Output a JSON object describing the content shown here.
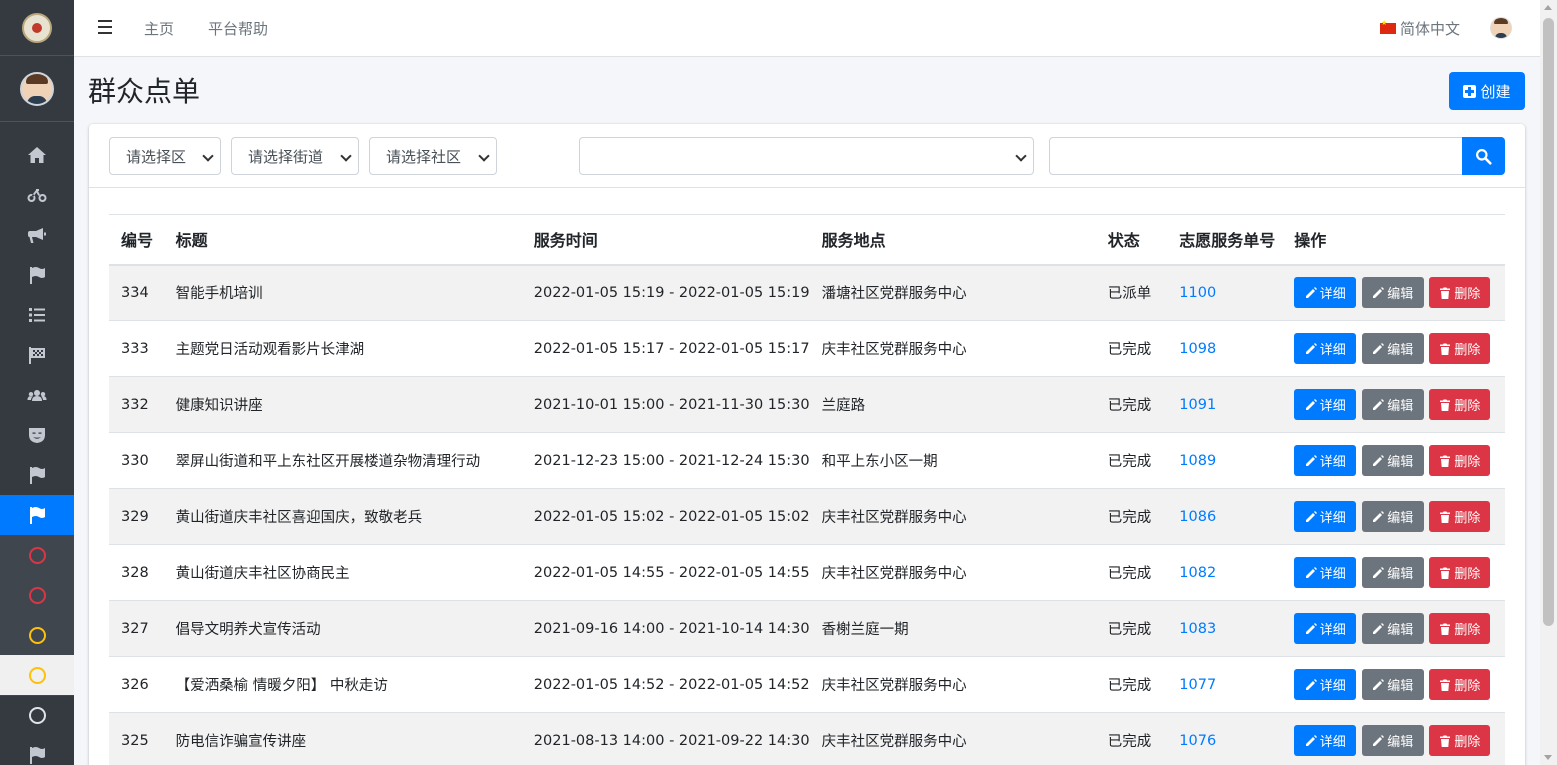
{
  "topbar": {
    "links": [
      "主页",
      "平台帮助"
    ],
    "language": "简体中文"
  },
  "page": {
    "title": "群众点单",
    "create_label": "创建"
  },
  "filters": {
    "district": "请选择区",
    "street": "请选择街道",
    "community": "请选择社区",
    "category": "",
    "search_value": ""
  },
  "table": {
    "headers": [
      "编号",
      "标题",
      "服务时间",
      "服务地点",
      "状态",
      "志愿服务单号",
      "操作"
    ],
    "actions": {
      "detail": "详细",
      "edit": "编辑",
      "delete": "删除"
    },
    "rows": [
      {
        "id": "334",
        "title": "智能手机培训",
        "time": "2022-01-05 15:19 - 2022-01-05 15:19",
        "place": "潘塘社区党群服务中心",
        "status": "已派单",
        "order": "1100"
      },
      {
        "id": "333",
        "title": "主题党日活动观看影片长津湖",
        "time": "2022-01-05 15:17 - 2022-01-05 15:17",
        "place": "庆丰社区党群服务中心",
        "status": "已完成",
        "order": "1098"
      },
      {
        "id": "332",
        "title": "健康知识讲座",
        "time": "2021-10-01 15:00 - 2021-11-30 15:30",
        "place": "兰庭路",
        "status": "已完成",
        "order": "1091"
      },
      {
        "id": "330",
        "title": "翠屏山街道和平上东社区开展楼道杂物清理行动",
        "time": "2021-12-23 15:00 - 2021-12-24 15:30",
        "place": "和平上东小区一期",
        "status": "已完成",
        "order": "1089"
      },
      {
        "id": "329",
        "title": "黄山街道庆丰社区喜迎国庆，致敬老兵",
        "time": "2022-01-05 15:02 - 2022-01-05 15:02",
        "place": "庆丰社区党群服务中心",
        "status": "已完成",
        "order": "1086"
      },
      {
        "id": "328",
        "title": "黄山街道庆丰社区协商民主",
        "time": "2022-01-05 14:55 - 2022-01-05 14:55",
        "place": "庆丰社区党群服务中心",
        "status": "已完成",
        "order": "1082"
      },
      {
        "id": "327",
        "title": "倡导文明养犬宣传活动",
        "time": "2021-09-16 14:00 - 2021-10-14 14:30",
        "place": "香榭兰庭一期",
        "status": "已完成",
        "order": "1083"
      },
      {
        "id": "326",
        "title": "【爱洒桑榆 情暖夕阳】 中秋走访",
        "time": "2022-01-05 14:52 - 2022-01-05 14:52",
        "place": "庆丰社区党群服务中心",
        "status": "已完成",
        "order": "1077"
      },
      {
        "id": "325",
        "title": "防电信诈骗宣传讲座",
        "time": "2021-08-13 14:00 - 2021-09-22 14:30",
        "place": "庆丰社区党群服务中心",
        "status": "已完成",
        "order": "1076"
      }
    ]
  },
  "colors": {
    "sidebar": "#343a40",
    "primary": "#007bff",
    "danger": "#dc3545",
    "secondary": "#6c757d",
    "success": "#28a745"
  }
}
